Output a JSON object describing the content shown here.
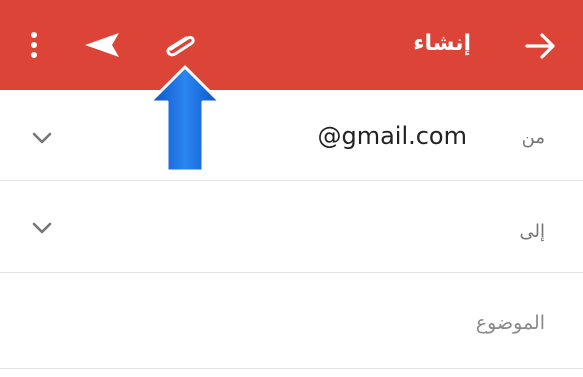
{
  "toolbar": {
    "title": "إنشاء",
    "background_color": "#db4437",
    "icons": [
      "more-vert-icon",
      "send-icon",
      "attach-icon",
      "back-arrow-icon"
    ]
  },
  "form": {
    "from_label": "من",
    "from_value": "@gmail.com",
    "to_label": "إلى",
    "subject_placeholder": "الموضوع"
  },
  "annotation": {
    "icon": "pointer-arrow-icon",
    "color": "#1a6ee6",
    "target": "attach-icon"
  }
}
